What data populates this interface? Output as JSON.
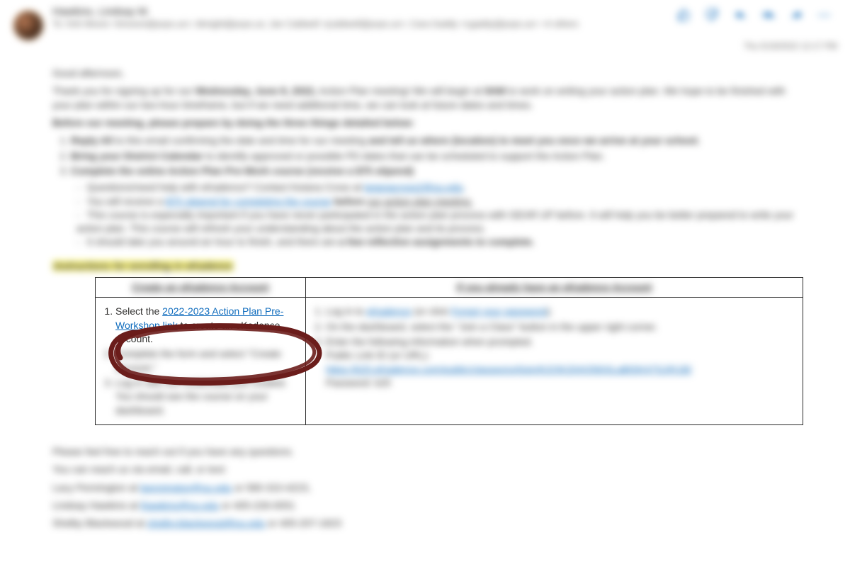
{
  "header": {
    "from": "Hawkins, Lindsay M.",
    "to_line": "To: Kirk Moore <kmoore@pvps.us>;  bknight@pvps.us;  Jan Caldwell <jcaldwell@pvps.us>;  Cara Gaddy <cgaddy@pvps.us>  +4 others",
    "timestamp": "Thu 5/19/2022 12:17 PM"
  },
  "body": {
    "greeting": "Good afternoon,",
    "intro_a": "Thank you for signing up for our ",
    "intro_date": "Wednesday, June 8, 2022,",
    "intro_b": " Action Plan meeting! We will begin at ",
    "intro_time": "9AM",
    "intro_c": " to work on writing your action plan. We hope to be finished with your plan within our two-hour timeframe, but if we need additional time, we can look at future dates and times.",
    "before_heading": "Before our meeting, please prepare by doing the three things detailed below:",
    "step1_a": "Reply All",
    "step1_b": " to this email confirming the date and time for our meeting ",
    "step1_c": "and tell us where (location) to meet you once we arrive at your school.",
    "step2_a": "Bring your District Calendar",
    "step2_b": " to identify approved or possible PD dates that can be scheduled to support the Action Plan.",
    "step3_a": "Complete the online Action Plan Pre-Work course (receive a $75 stipend)",
    "sub1_a": "Questions/need help with eKadence? Contact Keiana Cross at ",
    "sub1_link": "keianacross2@ou.edu",
    "sub2_a": "You will receive a ",
    "sub2_link": "$75 stipend for completing the course",
    "sub2_b": " before ",
    "sub2_c": "our action plan meeting.",
    "sub3": "This course is especially important if you have never participated in the action plan process with GEAR UP before. It will help you be better prepared to write your action plan. This course will refresh your understanding about the action plan and its process.",
    "sub4_a": "It should take you around an hour to finish, and there are ",
    "sub4_b": "a few reflective assignments to complete.",
    "highlight_heading": "Instructions for enrolling in eKadence",
    "table_left_header": "Create an eKadence Account",
    "table_right_header": "If you already have an eKadence Account",
    "left_1a": "Select the ",
    "left_1_link": "2022-2023 Action Plan Pre-Workshop link",
    "left_1b": " to create an eKadence account.",
    "left_2": "Complete the form and select \"Create account.\"",
    "left_3": "Log in with the credentials just created. You should see the course on your dashboard.",
    "right_1a": "Log in to ",
    "right_1_link1": "eKadence",
    "right_1b": " (or click ",
    "right_1_link2": "Forgot your password",
    "right_1c": ").",
    "right_2": "On the dashboard, select the \"Join a Class\" button in the upper right corner.",
    "right_3a": "Enter the following information when prompted.",
    "right_3b": "Public Link ID (or URL):",
    "right_3_link": "https://k20.eKadence.com/public/classes/url/join/K2OK20AQ56XiLaBtSK47SJ/K1B/",
    "right_3_pwd": "Password: k20",
    "questions": "Please feel free to reach out if you have any questions.",
    "reach": "You can reach us via email, call, or text:",
    "c1_a": "Lacy Pennington at ",
    "c1_link": "lpennington@ou.edu",
    "c1_b": " or 580-310-4223,",
    "c2_a": "Lindsay Hawkins at ",
    "c2_link": "lhawkins@ou.edu",
    "c2_b": " or 405-226-0051",
    "c3_a": "Shelby Blackwood at ",
    "c3_link": "shelby.blackwood@ou.edu",
    "c3_b": " or 405-207-1823"
  }
}
